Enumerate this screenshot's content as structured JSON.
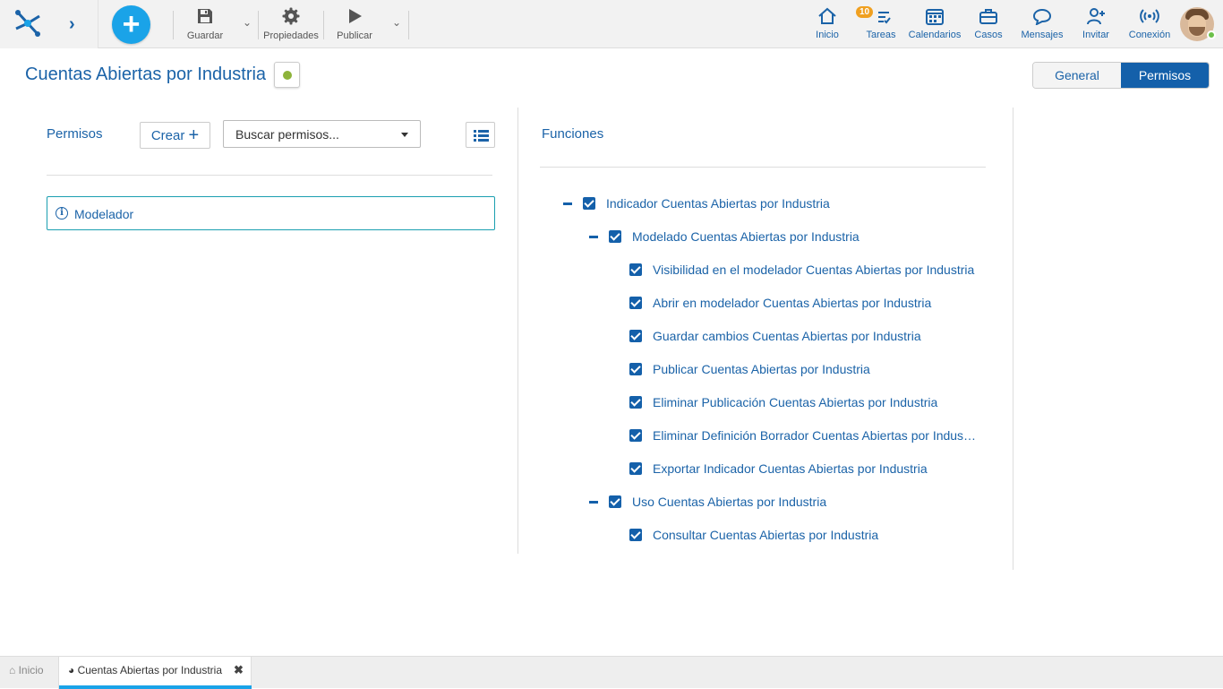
{
  "toolbar": {
    "save_label": "Guardar",
    "properties_label": "Propiedades",
    "publish_label": "Publicar"
  },
  "nav": {
    "home": "Inicio",
    "tasks": "Tareas",
    "tasks_badge": "10",
    "calendars": "Calendarios",
    "cases": "Casos",
    "messages": "Mensajes",
    "invite": "Invitar",
    "connection": "Conexión"
  },
  "page": {
    "title": "Cuentas Abiertas por Industria",
    "tabs": {
      "general": "General",
      "permisos": "Permisos"
    }
  },
  "permissions": {
    "label": "Permisos",
    "create_label": "Crear",
    "search_placeholder": "Buscar permisos...",
    "items": [
      {
        "label": "Modelador"
      }
    ]
  },
  "functions": {
    "label": "Funciones",
    "tree": [
      {
        "label": "Indicador Cuentas Abiertas por Industria",
        "checked": true
      },
      {
        "label": "Modelado Cuentas Abiertas por Industria",
        "checked": true
      },
      {
        "label": "Visibilidad en el modelador Cuentas Abiertas por Industria",
        "checked": true
      },
      {
        "label": "Abrir en modelador Cuentas Abiertas por Industria",
        "checked": true
      },
      {
        "label": "Guardar cambios Cuentas Abiertas por Industria",
        "checked": true
      },
      {
        "label": "Publicar Cuentas Abiertas por Industria",
        "checked": true
      },
      {
        "label": "Eliminar Publicación Cuentas Abiertas por Industria",
        "checked": true
      },
      {
        "label": "Eliminar Definición Borrador Cuentas Abiertas por Indus…",
        "checked": true
      },
      {
        "label": "Exportar Indicador Cuentas Abiertas por Industria",
        "checked": true
      },
      {
        "label": "Uso Cuentas Abiertas por Industria",
        "checked": true
      },
      {
        "label": "Consultar Cuentas Abiertas por Industria",
        "checked": true
      }
    ]
  },
  "bottom_tabs": {
    "home": "Inicio",
    "active": "Cuentas Abiertas por Industria"
  },
  "colors": {
    "brand_blue": "#1b63a8",
    "fab": "#1aa3e8",
    "active_tab": "#1460aa",
    "badge": "#f0a020",
    "status_green": "#8db33a"
  }
}
